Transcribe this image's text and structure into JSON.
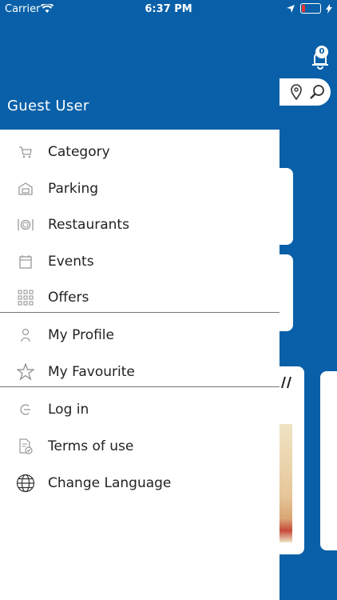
{
  "status_bar": {
    "carrier": "Carrier",
    "time": "6:37 PM"
  },
  "header": {
    "user_name": "Guest User",
    "notification_count": "0"
  },
  "menu": {
    "items": [
      {
        "label": "Category",
        "icon": "cart-icon"
      },
      {
        "label": "Parking",
        "icon": "garage-icon"
      },
      {
        "label": "Restaurants",
        "icon": "plate-cutlery-icon"
      },
      {
        "label": "Events",
        "icon": "calendar-icon"
      },
      {
        "label": "Offers",
        "icon": "grid-icon"
      },
      {
        "label": "My Profile",
        "icon": "user-icon"
      },
      {
        "label": "My Favourite",
        "icon": "star-icon"
      },
      {
        "label": "Log in",
        "icon": "login-icon"
      },
      {
        "label": "Terms of use",
        "icon": "document-check-icon"
      },
      {
        "label": "Change Language",
        "icon": "globe-icon"
      }
    ]
  },
  "colors": {
    "brand": "#0960a8",
    "drawer_bg": "#ffffff",
    "text": "#222222"
  }
}
